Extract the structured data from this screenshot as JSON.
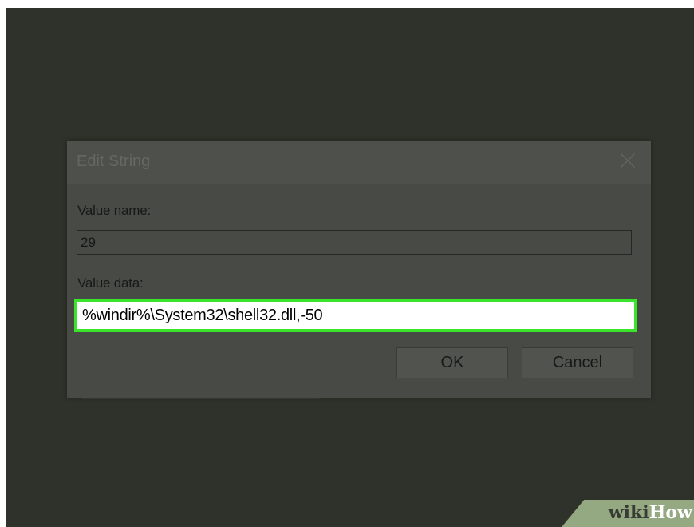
{
  "dialog": {
    "title": "Edit String",
    "close_icon": "close-icon",
    "value_name_label": "Value name:",
    "value_name": "29",
    "value_data_label": "Value data:",
    "value_data": "%windir%\\System32\\shell32.dll,-50",
    "ok_label": "OK",
    "cancel_label": "Cancel"
  },
  "watermark": {
    "brand_first": "wiki",
    "brand_second": "How"
  },
  "colors": {
    "background": "#2f322a",
    "dialog": "#474a45",
    "highlight": "#39e42a",
    "watermark": "#94a981"
  }
}
